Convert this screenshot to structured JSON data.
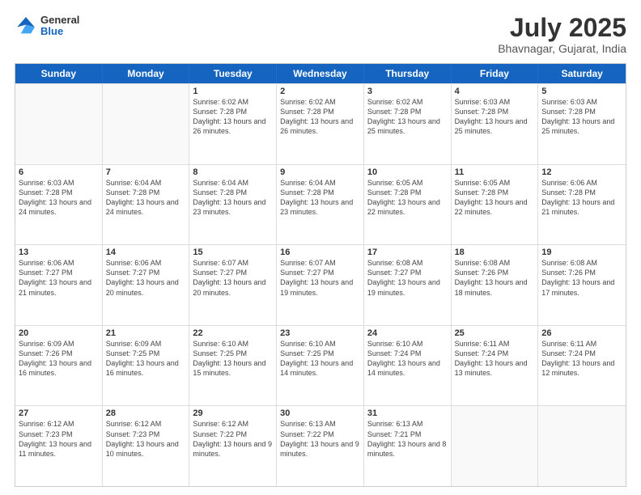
{
  "header": {
    "logo": {
      "general": "General",
      "blue": "Blue"
    },
    "title": "July 2025",
    "location": "Bhavnagar, Gujarat, India"
  },
  "weekdays": [
    "Sunday",
    "Monday",
    "Tuesday",
    "Wednesday",
    "Thursday",
    "Friday",
    "Saturday"
  ],
  "weeks": [
    [
      {
        "day": "",
        "empty": true
      },
      {
        "day": "",
        "empty": true
      },
      {
        "day": "1",
        "sunrise": "Sunrise: 6:02 AM",
        "sunset": "Sunset: 7:28 PM",
        "daylight": "Daylight: 13 hours and 26 minutes."
      },
      {
        "day": "2",
        "sunrise": "Sunrise: 6:02 AM",
        "sunset": "Sunset: 7:28 PM",
        "daylight": "Daylight: 13 hours and 26 minutes."
      },
      {
        "day": "3",
        "sunrise": "Sunrise: 6:02 AM",
        "sunset": "Sunset: 7:28 PM",
        "daylight": "Daylight: 13 hours and 25 minutes."
      },
      {
        "day": "4",
        "sunrise": "Sunrise: 6:03 AM",
        "sunset": "Sunset: 7:28 PM",
        "daylight": "Daylight: 13 hours and 25 minutes."
      },
      {
        "day": "5",
        "sunrise": "Sunrise: 6:03 AM",
        "sunset": "Sunset: 7:28 PM",
        "daylight": "Daylight: 13 hours and 25 minutes."
      }
    ],
    [
      {
        "day": "6",
        "sunrise": "Sunrise: 6:03 AM",
        "sunset": "Sunset: 7:28 PM",
        "daylight": "Daylight: 13 hours and 24 minutes."
      },
      {
        "day": "7",
        "sunrise": "Sunrise: 6:04 AM",
        "sunset": "Sunset: 7:28 PM",
        "daylight": "Daylight: 13 hours and 24 minutes."
      },
      {
        "day": "8",
        "sunrise": "Sunrise: 6:04 AM",
        "sunset": "Sunset: 7:28 PM",
        "daylight": "Daylight: 13 hours and 23 minutes."
      },
      {
        "day": "9",
        "sunrise": "Sunrise: 6:04 AM",
        "sunset": "Sunset: 7:28 PM",
        "daylight": "Daylight: 13 hours and 23 minutes."
      },
      {
        "day": "10",
        "sunrise": "Sunrise: 6:05 AM",
        "sunset": "Sunset: 7:28 PM",
        "daylight": "Daylight: 13 hours and 22 minutes."
      },
      {
        "day": "11",
        "sunrise": "Sunrise: 6:05 AM",
        "sunset": "Sunset: 7:28 PM",
        "daylight": "Daylight: 13 hours and 22 minutes."
      },
      {
        "day": "12",
        "sunrise": "Sunrise: 6:06 AM",
        "sunset": "Sunset: 7:28 PM",
        "daylight": "Daylight: 13 hours and 21 minutes."
      }
    ],
    [
      {
        "day": "13",
        "sunrise": "Sunrise: 6:06 AM",
        "sunset": "Sunset: 7:27 PM",
        "daylight": "Daylight: 13 hours and 21 minutes."
      },
      {
        "day": "14",
        "sunrise": "Sunrise: 6:06 AM",
        "sunset": "Sunset: 7:27 PM",
        "daylight": "Daylight: 13 hours and 20 minutes."
      },
      {
        "day": "15",
        "sunrise": "Sunrise: 6:07 AM",
        "sunset": "Sunset: 7:27 PM",
        "daylight": "Daylight: 13 hours and 20 minutes."
      },
      {
        "day": "16",
        "sunrise": "Sunrise: 6:07 AM",
        "sunset": "Sunset: 7:27 PM",
        "daylight": "Daylight: 13 hours and 19 minutes."
      },
      {
        "day": "17",
        "sunrise": "Sunrise: 6:08 AM",
        "sunset": "Sunset: 7:27 PM",
        "daylight": "Daylight: 13 hours and 19 minutes."
      },
      {
        "day": "18",
        "sunrise": "Sunrise: 6:08 AM",
        "sunset": "Sunset: 7:26 PM",
        "daylight": "Daylight: 13 hours and 18 minutes."
      },
      {
        "day": "19",
        "sunrise": "Sunrise: 6:08 AM",
        "sunset": "Sunset: 7:26 PM",
        "daylight": "Daylight: 13 hours and 17 minutes."
      }
    ],
    [
      {
        "day": "20",
        "sunrise": "Sunrise: 6:09 AM",
        "sunset": "Sunset: 7:26 PM",
        "daylight": "Daylight: 13 hours and 16 minutes."
      },
      {
        "day": "21",
        "sunrise": "Sunrise: 6:09 AM",
        "sunset": "Sunset: 7:25 PM",
        "daylight": "Daylight: 13 hours and 16 minutes."
      },
      {
        "day": "22",
        "sunrise": "Sunrise: 6:10 AM",
        "sunset": "Sunset: 7:25 PM",
        "daylight": "Daylight: 13 hours and 15 minutes."
      },
      {
        "day": "23",
        "sunrise": "Sunrise: 6:10 AM",
        "sunset": "Sunset: 7:25 PM",
        "daylight": "Daylight: 13 hours and 14 minutes."
      },
      {
        "day": "24",
        "sunrise": "Sunrise: 6:10 AM",
        "sunset": "Sunset: 7:24 PM",
        "daylight": "Daylight: 13 hours and 14 minutes."
      },
      {
        "day": "25",
        "sunrise": "Sunrise: 6:11 AM",
        "sunset": "Sunset: 7:24 PM",
        "daylight": "Daylight: 13 hours and 13 minutes."
      },
      {
        "day": "26",
        "sunrise": "Sunrise: 6:11 AM",
        "sunset": "Sunset: 7:24 PM",
        "daylight": "Daylight: 13 hours and 12 minutes."
      }
    ],
    [
      {
        "day": "27",
        "sunrise": "Sunrise: 6:12 AM",
        "sunset": "Sunset: 7:23 PM",
        "daylight": "Daylight: 13 hours and 11 minutes."
      },
      {
        "day": "28",
        "sunrise": "Sunrise: 6:12 AM",
        "sunset": "Sunset: 7:23 PM",
        "daylight": "Daylight: 13 hours and 10 minutes."
      },
      {
        "day": "29",
        "sunrise": "Sunrise: 6:12 AM",
        "sunset": "Sunset: 7:22 PM",
        "daylight": "Daylight: 13 hours and 9 minutes."
      },
      {
        "day": "30",
        "sunrise": "Sunrise: 6:13 AM",
        "sunset": "Sunset: 7:22 PM",
        "daylight": "Daylight: 13 hours and 9 minutes."
      },
      {
        "day": "31",
        "sunrise": "Sunrise: 6:13 AM",
        "sunset": "Sunset: 7:21 PM",
        "daylight": "Daylight: 13 hours and 8 minutes."
      },
      {
        "day": "",
        "empty": true
      },
      {
        "day": "",
        "empty": true
      }
    ]
  ]
}
